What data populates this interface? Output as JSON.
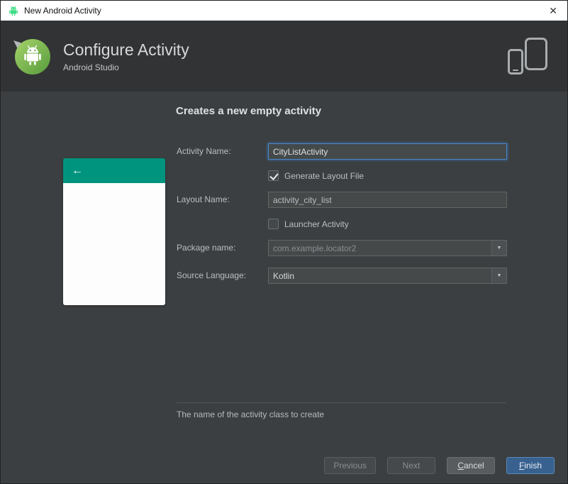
{
  "window": {
    "title": "New Android Activity",
    "close": "✕"
  },
  "header": {
    "title": "Configure Activity",
    "subtitle": "Android Studio"
  },
  "content": {
    "heading": "Creates a new empty activity",
    "preview": {
      "back_arrow": "←"
    },
    "form": {
      "activity_name": {
        "label": "Activity Name:",
        "value": "CityListActivity"
      },
      "generate_layout": {
        "label": "Generate Layout File",
        "checked": true
      },
      "layout_name": {
        "label": "Layout Name:",
        "value": "activity_city_list"
      },
      "launcher_activity": {
        "label": "Launcher Activity",
        "checked": false
      },
      "package_name": {
        "label": "Package name:",
        "value": "com.example.locator2"
      },
      "source_language": {
        "label": "Source Language:",
        "value": "Kotlin"
      }
    },
    "status": "The name of the activity class to create"
  },
  "icons": {
    "dropdown_arrow": "▼"
  },
  "footer": {
    "previous": "Previous",
    "next": "Next",
    "cancel": "Cancel",
    "finish": "Finish"
  },
  "colors": {
    "preview_header_teal": "#00947e",
    "focus_border_blue": "#4a88c9",
    "finish_button_blue": "#38618f",
    "android_green": "#3ddc84",
    "panel_background": "#3c3f41",
    "header_background": "#313335"
  }
}
